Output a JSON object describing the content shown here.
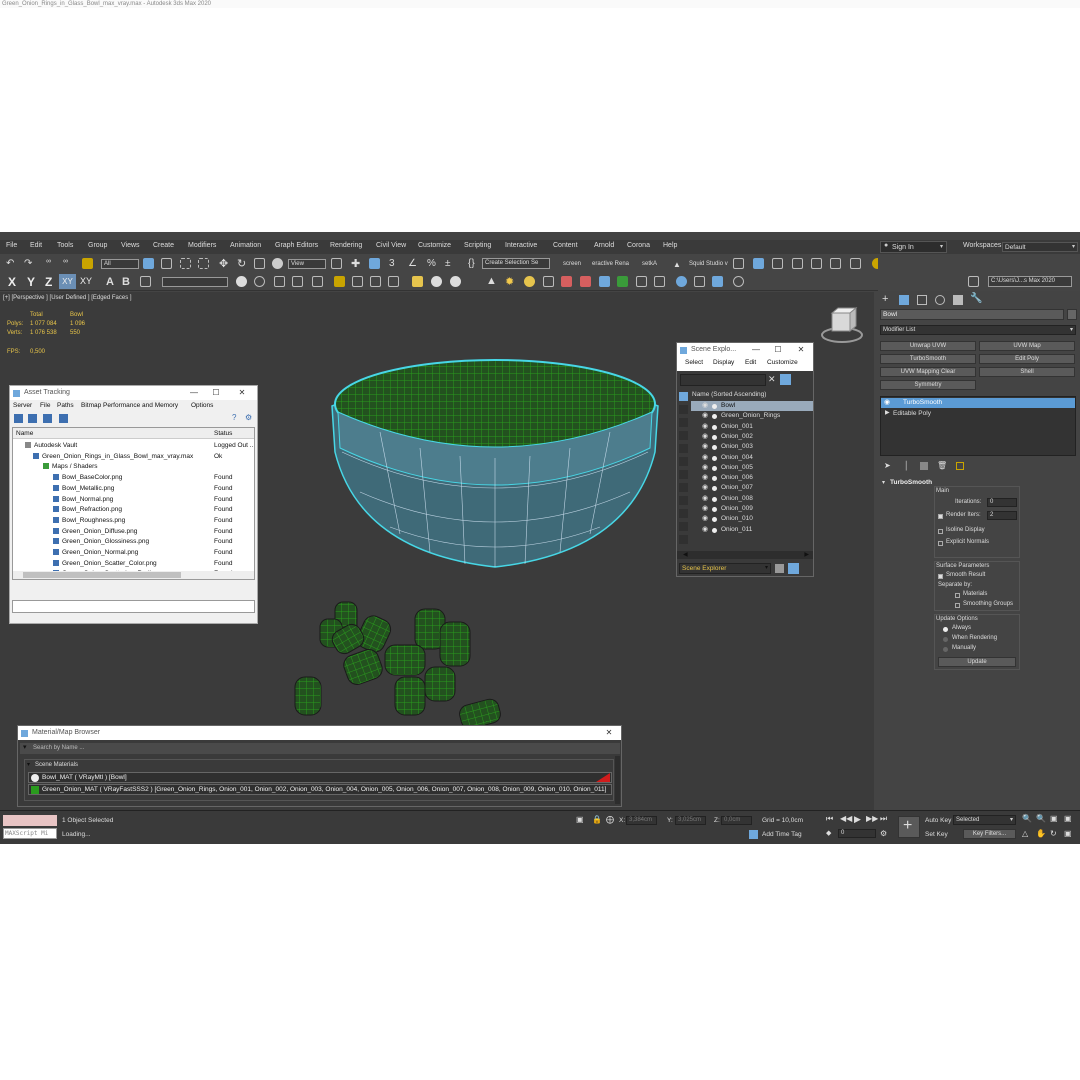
{
  "window": {
    "title": "Green_Onion_Rings_in_Glass_Bowl_max_vray.max - Autodesk 3ds Max 2020"
  },
  "menu": [
    "File",
    "Edit",
    "Tools",
    "Group",
    "Views",
    "Create",
    "Modifiers",
    "Animation",
    "Graph Editors",
    "Rendering",
    "Civil View",
    "Customize",
    "Scripting",
    "Interactive",
    "Content",
    "Arnold",
    "Corona",
    "Help"
  ],
  "signin": "Sign In",
  "workspaces": {
    "label": "Workspaces:",
    "value": "Default"
  },
  "toolbar": {
    "filter": "All",
    "refcoord": "View",
    "selset": "Create Selection Se",
    "screen": "screen",
    "interactive": "eractive Rena",
    "setka": "setkA",
    "squid": "Squid Studio v",
    "path": "C:\\Users\\J...s Max 2020",
    "axes": [
      "X",
      "Y",
      "Z",
      "XY",
      "XY"
    ]
  },
  "viewport": {
    "label": "[+] [Perspective ] [User Defined ] [Edged Faces ]",
    "stats": {
      "col_total": "Total",
      "col_obj": "Bowl",
      "polys_label": "Polys:",
      "polys_total": "1 077 084",
      "polys_obj": "1 096",
      "verts_label": "Verts:",
      "verts_total": "1 076 538",
      "verts_obj": "550",
      "fps_label": "FPS:",
      "fps_value": "0,500"
    }
  },
  "asset": {
    "title": "Asset Tracking",
    "menu": [
      "Server",
      "File",
      "Paths",
      "Bitmap Performance and Memory",
      "Options"
    ],
    "col_name": "Name",
    "col_status": "Status",
    "rows": [
      {
        "name": "Autodesk Vault",
        "status": "Logged Out ..."
      },
      {
        "name": "Green_Onion_Rings_in_Glass_Bowl_max_vray.max",
        "status": "Ok"
      },
      {
        "name": "Maps / Shaders",
        "status": ""
      },
      {
        "name": "Bowl_BaseColor.png",
        "status": "Found"
      },
      {
        "name": "Bowl_Metallic.png",
        "status": "Found"
      },
      {
        "name": "Bowl_Normal.png",
        "status": "Found"
      },
      {
        "name": "Bowl_Refraction.png",
        "status": "Found"
      },
      {
        "name": "Bowl_Roughness.png",
        "status": "Found"
      },
      {
        "name": "Green_Onion_Diffuse.png",
        "status": "Found"
      },
      {
        "name": "Green_Onion_Glossiness.png",
        "status": "Found"
      },
      {
        "name": "Green_Onion_Normal.png",
        "status": "Found"
      },
      {
        "name": "Green_Onion_Scatter_Color.png",
        "status": "Found"
      },
      {
        "name": "Green_Onion_Scattering_Radius.png",
        "status": "Found"
      }
    ]
  },
  "scene": {
    "title": "Scene Explo...",
    "menu": [
      "Select",
      "Display",
      "Edit",
      "Customize"
    ],
    "header": "Name (Sorted Ascending)",
    "items": [
      "Bowl",
      "Green_Onion_Rings",
      "Onion_001",
      "Onion_002",
      "Onion_003",
      "Onion_004",
      "Onion_005",
      "Onion_006",
      "Onion_007",
      "Onion_008",
      "Onion_009",
      "Onion_010",
      "Onion_011"
    ],
    "footer": "Scene Explorer"
  },
  "matbrowser": {
    "title": "Material/Map Browser",
    "search": "Search by Name ...",
    "section": "Scene Materials",
    "items": [
      "Bowl_MAT  ( VRayMtl ) [Bowl]",
      "Green_Onion_MAT  ( VRayFastSSS2 ) [Green_Onion_Rings, Onion_001, Onion_002, Onion_003, Onion_004, Onion_005, Onion_006, Onion_007, Onion_008, Onion_009, Onion_010, Onion_011]"
    ]
  },
  "modify": {
    "object": "Bowl",
    "modlist": "Modifier List",
    "buttons": [
      "Unwrap UVW",
      "UVW Map",
      "TurboSmooth",
      "Edit Poly",
      "UVW Mapping Clear",
      "Shell",
      "Symmetry"
    ],
    "stack": [
      "TurboSmooth",
      "Editable Poly"
    ],
    "rollout": "TurboSmooth",
    "main": "Main",
    "iterations_label": "Iterations:",
    "iterations": "0",
    "render_iters_label": "Render Iters:",
    "render_iters": "2",
    "isoline": "Isoline Display",
    "explicit": "Explicit Normals",
    "surface": "Surface Parameters",
    "smooth_result": "Smooth Result",
    "separate": "Separate by:",
    "materials": "Materials",
    "smoothing": "Smoothing Groups",
    "update_options": "Update Options",
    "always": "Always",
    "when_rendering": "When Rendering",
    "manually": "Manually",
    "update": "Update"
  },
  "status": {
    "maxscript": "MAXScript Mi",
    "selected": "1 Object Selected",
    "loading": "Loading...",
    "x_label": "X:",
    "x": "3,384cm",
    "y_label": "Y:",
    "y": "3,025cm",
    "z_label": "Z:",
    "z": "0,0cm",
    "grid": "Grid = 10,0cm",
    "addtimetag": "Add Time Tag",
    "autokey": "Auto Key",
    "selected_dd": "Selected",
    "setkey": "Set Key",
    "keyfilters": "Key Filters...",
    "frame": "0"
  },
  "colors": {
    "accent": "#5b9bd5",
    "wire": "#47d7e6",
    "onion": "#2a9b1e"
  }
}
